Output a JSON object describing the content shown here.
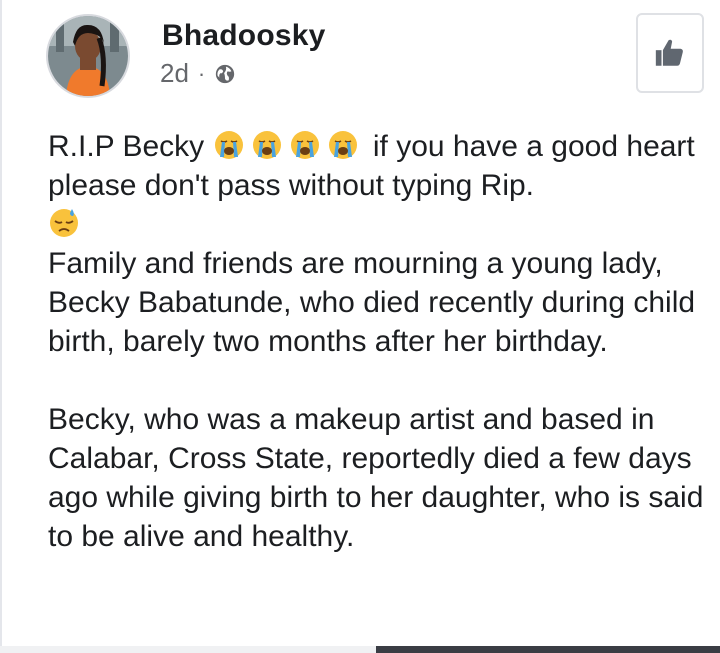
{
  "post": {
    "author": "Bhadoosky",
    "time": "2d",
    "separator": "·",
    "privacy_icon": "globe-icon",
    "like_icon": "thumbs-up-icon",
    "line1_prefix": "R.I.P Becky",
    "line1_emojis": [
      "crying-face-emoji",
      "crying-face-emoji",
      "crying-face-emoji",
      "crying-face-emoji"
    ],
    "line1_suffix": "if you have a good heart please don't pass without typing Rip.",
    "line2_emoji": "downcast-sweat-face-emoji",
    "paragraph1": "Family and friends are mourning a young lady, Becky Babatunde, who died recently during child birth, barely two months after her birthday.",
    "paragraph2": "Becky, who was a makeup artist and based in Calabar, Cross State, reportedly died a few days ago while giving birth to her daughter, who is said to be alive and healthy."
  },
  "colors": {
    "text": "#1c1e21",
    "meta": "#65676b",
    "emoji_face": "#f9c23c",
    "tears": "#4aa3df"
  }
}
